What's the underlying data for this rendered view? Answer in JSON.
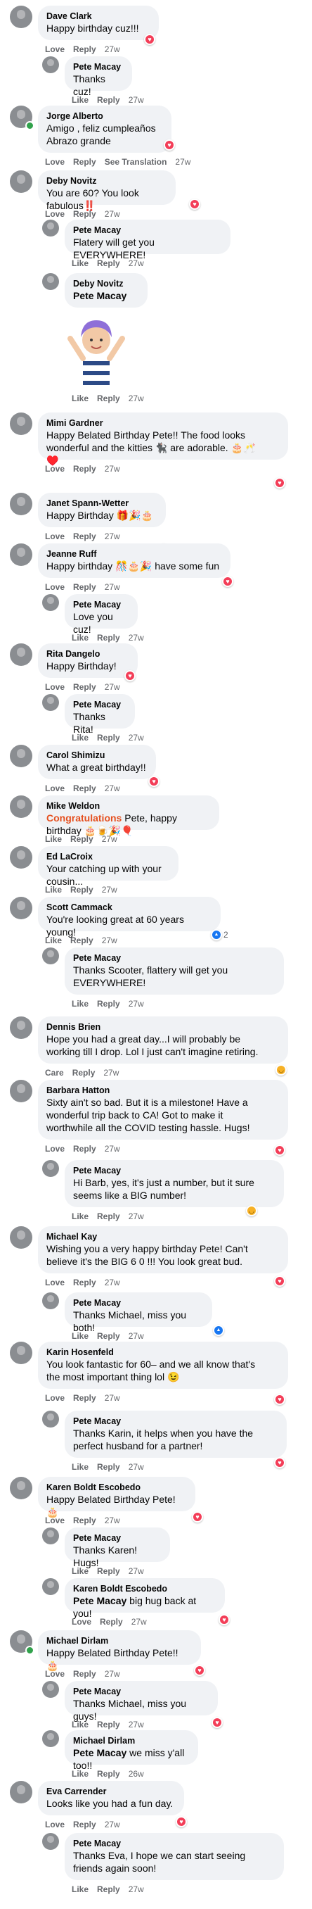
{
  "ui": {
    "love_label": "Love",
    "like_label": "Like",
    "care_label": "Care",
    "reply_label": "Reply",
    "see_translation_label": "See Translation"
  },
  "colors": {
    "bubble": "#f0f2f5",
    "love": "#f33e58",
    "like": "#1877f2",
    "haha": "#f7b125",
    "meta": "#65676b",
    "highlight": "#e5501f"
  },
  "comments": [
    {
      "name": "Dave Clark",
      "text": "Happy birthday cuz!!!",
      "reaction_label": "Love",
      "time": "27w",
      "reactions": [
        "love"
      ],
      "replies": [
        {
          "name": "Pete Macay",
          "text": "Thanks cuz!",
          "reaction_label": "Like",
          "time": "27w",
          "reactions": []
        }
      ]
    },
    {
      "name": "Jorge Alberto",
      "text": "Amigo , feliz cumpleaños\nAbrazo grande",
      "reaction_label": "Love",
      "time": "27w",
      "translate": "See Translation",
      "reactions": [
        "love"
      ]
    },
    {
      "name": "Deby Novitz",
      "text": "You are 60? You look fabulous‼️",
      "reaction_label": "Love",
      "time": "27w",
      "reactions": [
        "love"
      ],
      "replies": [
        {
          "name": "Pete Macay",
          "text": "Flatery will get you EVERYWHERE!",
          "reaction_label": "Like",
          "time": "27w",
          "reactions": []
        },
        {
          "name": "Deby Novitz",
          "tag": "Pete Macay",
          "text": "",
          "reaction_label": "Like",
          "time": "27w",
          "sticker": "waving-avatar-sticker",
          "reactions": []
        }
      ]
    },
    {
      "name": "Mimi Gardner",
      "text": "Happy Belated Birthday Pete!! The food looks wonderful and the kitties 🐈‍⬛ are adorable. 🎂🥂\n♥️",
      "reaction_label": "Love",
      "time": "27w",
      "reactions": [
        "love"
      ]
    },
    {
      "name": "Janet Spann-Wetter",
      "text": "Happy Birthday 🎁🎉🎂",
      "reaction_label": "Love",
      "time": "27w",
      "reactions": [
        "love"
      ]
    },
    {
      "name": "Jeanne Ruff",
      "text": "Happy birthday 🎊🎂🎉 have some fun",
      "reaction_label": "Love",
      "time": "27w",
      "reactions": [
        "love"
      ],
      "replies": [
        {
          "name": "Pete Macay",
          "text": "Love you cuz!",
          "reaction_label": "Like",
          "time": "27w",
          "reactions": []
        }
      ]
    },
    {
      "name": "Rita Dangelo",
      "text": "Happy Birthday!",
      "reaction_label": "Love",
      "time": "27w",
      "reactions": [
        "love"
      ],
      "replies": [
        {
          "name": "Pete Macay",
          "text": "Thanks Rita!",
          "reaction_label": "Like",
          "time": "27w",
          "reactions": []
        }
      ]
    },
    {
      "name": "Carol Shimizu",
      "text": "What a great birthday!!",
      "reaction_label": "Love",
      "time": "27w",
      "reactions": [
        "love"
      ]
    },
    {
      "name": "Mike Weldon",
      "highlight": "Congratulations",
      "text": " Pete, happy birthday 🎂🍺🎉🎈",
      "reaction_label": "Like",
      "time": "27w",
      "reactions": []
    },
    {
      "name": "Ed LaCroix",
      "text": "Your catching up with your cousin...",
      "reaction_label": "Like",
      "time": "27w",
      "reactions": []
    },
    {
      "name": "Scott Cammack",
      "text": "You're looking great at 60 years young!",
      "reaction_label": "Like",
      "time": "27w",
      "reactions": [
        "like"
      ],
      "reaction_count": "2",
      "replies": [
        {
          "name": "Pete Macay",
          "text": "Thanks Scooter, flattery will get you\nEVERYWHERE!",
          "reaction_label": "Like",
          "time": "27w",
          "reactions": []
        }
      ]
    },
    {
      "name": "Dennis Brien",
      "text": "Hope you had a great day...I will probably be\nworking till I drop. Lol I just can't imagine retiring.",
      "reaction_label": "Care",
      "time": "27w",
      "reactions": [
        "haha"
      ]
    },
    {
      "name": "Barbara Hatton",
      "text": "Sixty ain't so bad. But it is a milestone! Have a\nwonderful trip back to CA! Got to make it\nworthwhile all the COVID testing hassle. Hugs!",
      "reaction_label": "Love",
      "time": "27w",
      "reactions": [
        "love"
      ],
      "replies": [
        {
          "name": "Pete Macay",
          "text": "Hi Barb, yes, it's just a number, but it sure\nseems like a BIG number!",
          "reaction_label": "Like",
          "time": "27w",
          "reactions": [
            "haha"
          ]
        }
      ]
    },
    {
      "name": "Michael Kay",
      "text": "Wishing you a very happy birthday Pete! Can't\nbelieve it's the BIG 6 0 !!! You look great bud.",
      "reaction_label": "Love",
      "time": "27w",
      "reactions": [
        "love"
      ],
      "replies": [
        {
          "name": "Pete Macay",
          "text": "Thanks Michael, miss you both!",
          "reaction_label": "Like",
          "time": "27w",
          "reactions": [
            "like"
          ]
        }
      ]
    },
    {
      "name": "Karin Hosenfeld",
      "text": "You look fantastic for 60– and we all know that's\nthe most important thing lol 😉",
      "reaction_label": "Love",
      "time": "27w",
      "reactions": [
        "love"
      ],
      "replies": [
        {
          "name": "Pete Macay",
          "text": "Thanks Karin, it helps when you have the\nperfect husband for a partner!",
          "reaction_label": "Like",
          "time": "27w",
          "reactions": [
            "love"
          ]
        }
      ]
    },
    {
      "name": "Karen Boldt Escobedo",
      "text": "Happy Belated Birthday Pete! 🎂",
      "reaction_label": "Love",
      "time": "27w",
      "reactions": [
        "love"
      ],
      "replies": [
        {
          "name": "Pete Macay",
          "text": "Thanks Karen! Hugs!",
          "reaction_label": "Like",
          "time": "27w",
          "reactions": []
        },
        {
          "name": "Karen Boldt Escobedo",
          "tag": "Pete Macay",
          "text": " big hug back at you!",
          "reaction_label": "Love",
          "time": "27w",
          "reactions": [
            "love"
          ]
        }
      ]
    },
    {
      "name": "Michael Dirlam",
      "text": "Happy Belated Birthday Pete!! 🎂",
      "reaction_label": "Love",
      "time": "27w",
      "reactions": [
        "love"
      ],
      "replies": [
        {
          "name": "Pete Macay",
          "text": "Thanks Michael, miss you guys!",
          "reaction_label": "Like",
          "time": "27w",
          "reactions": [
            "love"
          ]
        },
        {
          "name": "Michael Dirlam",
          "tag": "Pete Macay",
          "text": " we miss y'all too!!",
          "reaction_label": "Like",
          "time": "26w",
          "reactions": []
        }
      ]
    },
    {
      "name": "Eva Carrender",
      "text": "Looks like you had a fun day.",
      "reaction_label": "Love",
      "time": "27w",
      "reactions": [
        "love"
      ],
      "replies": [
        {
          "name": "Pete Macay",
          "text": "Thanks Eva, I hope we can start seeing\nfriends again soon!",
          "reaction_label": "Like",
          "time": "27w",
          "reactions": []
        }
      ]
    }
  ]
}
